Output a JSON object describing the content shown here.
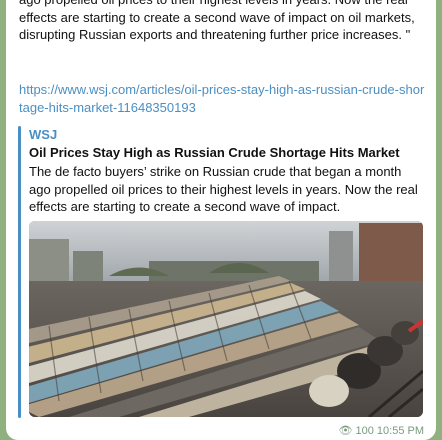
{
  "message": {
    "text": "ago propelled oil prices to their highest levels in years. Now the real effects are starting to create a second wave of impact on oil markets, disrupting Russian exports and threatening further price increases. \"",
    "link": "https://www.wsj.com/articles/oil-prices-stay-high-as-russian-crude-shortage-hits-market-11648350193"
  },
  "preview": {
    "site": "WSJ",
    "title": "Oil Prices Stay High as Russian Crude Shortage Hits Market",
    "description": "The de facto buyers’ strike on Russian crude that began a month ago propelled oil prices to their highest levels in years. Now the real effects are starting to create a second wave of impact.",
    "image_subject": "rail yard with rows of oil tank cars"
  },
  "meta": {
    "views": "100",
    "time": "10:55 PM"
  },
  "colors": {
    "background": "#8fb07f",
    "bubble": "#ffffff",
    "accent": "#4a8fc4"
  }
}
